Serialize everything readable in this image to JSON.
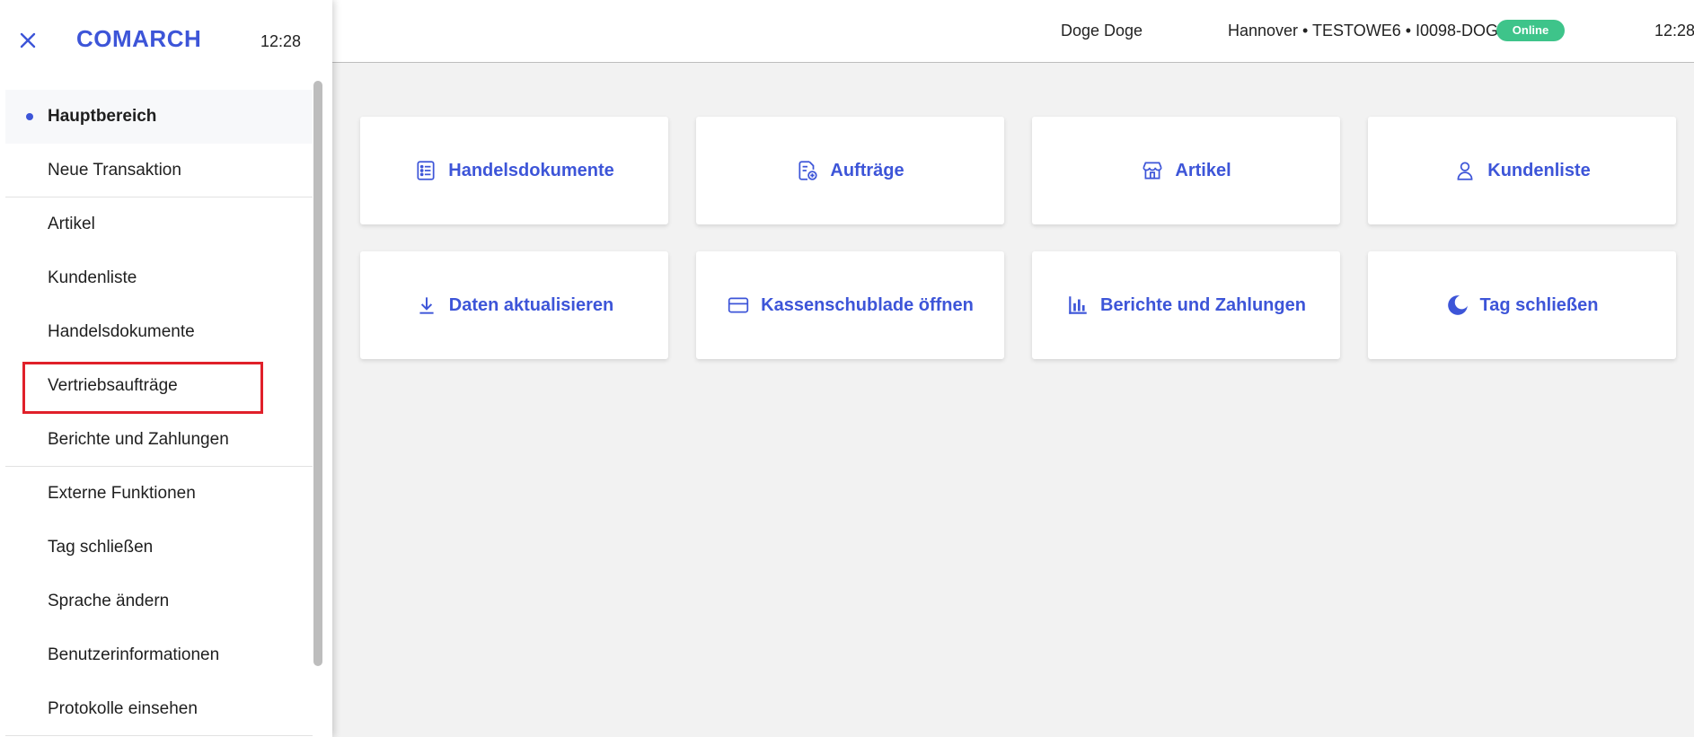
{
  "header": {
    "user_name": "Doge Doge",
    "location": "Hannover • TESTOWE6 • I0098-DOGE",
    "status": "Online",
    "time": "12:28"
  },
  "tiles": [
    {
      "label": "Handelsdokumente",
      "icon": "list-document-icon"
    },
    {
      "label": "Aufträge",
      "icon": "order-document-icon"
    },
    {
      "label": "Artikel",
      "icon": "store-icon"
    },
    {
      "label": "Kundenliste",
      "icon": "person-icon"
    },
    {
      "label": "Daten aktualisieren",
      "icon": "download-icon"
    },
    {
      "label": "Kassenschublade öffnen",
      "icon": "card-icon"
    },
    {
      "label": "Berichte und Zahlungen",
      "icon": "bar-chart-icon"
    },
    {
      "label": "Tag schließen",
      "icon": "moon-icon"
    }
  ],
  "sidebar": {
    "logo": "COMARCH",
    "time": "12:28",
    "items": [
      {
        "label": "Hauptbereich"
      },
      {
        "label": "Neue Transaktion"
      },
      {
        "label": "Artikel"
      },
      {
        "label": "Kundenliste"
      },
      {
        "label": "Handelsdokumente"
      },
      {
        "label": "Vertriebsaufträge"
      },
      {
        "label": "Berichte und Zahlungen"
      },
      {
        "label": "Externe Funktionen"
      },
      {
        "label": "Tag schließen"
      },
      {
        "label": "Sprache ändern"
      },
      {
        "label": "Benutzerinformationen"
      },
      {
        "label": "Protokolle einsehen"
      }
    ]
  },
  "colors": {
    "accent": "#3d55d8",
    "online": "#3ec48a",
    "highlight_border": "#e0202a",
    "background": "#f2f2f2"
  }
}
